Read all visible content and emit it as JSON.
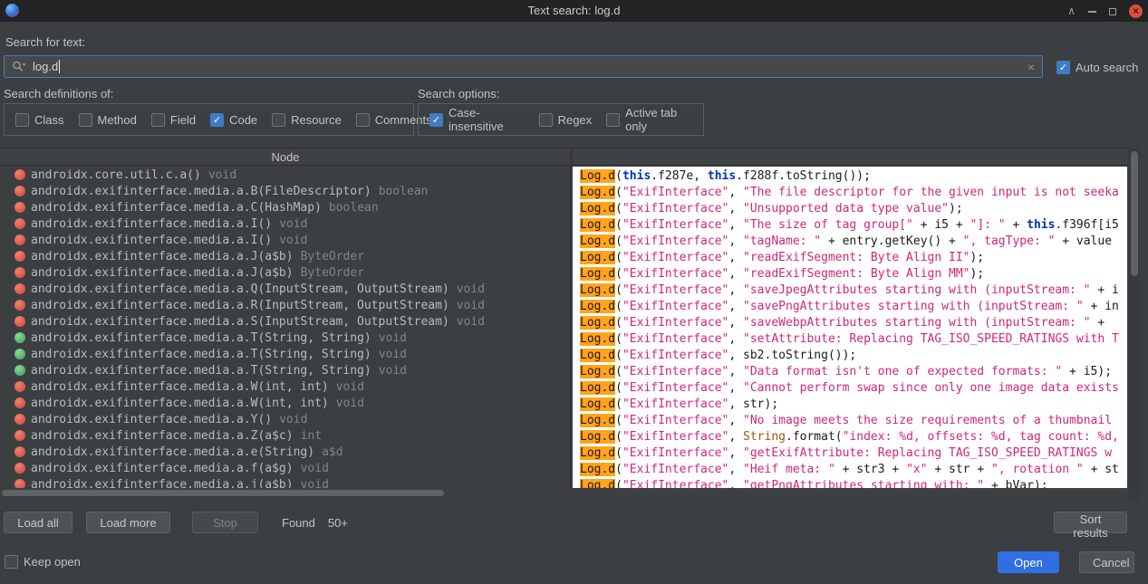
{
  "window": {
    "title": "Text search: log.d"
  },
  "search": {
    "label": "Search for text:",
    "value": "log.d",
    "clear_icon": "×",
    "auto_search": {
      "label": "Auto search",
      "checked": true
    }
  },
  "definitions": {
    "title": "Search definitions of:",
    "options": [
      {
        "label": "Class",
        "checked": false
      },
      {
        "label": "Method",
        "checked": false
      },
      {
        "label": "Field",
        "checked": false
      },
      {
        "label": "Code",
        "checked": true
      },
      {
        "label": "Resource",
        "checked": false
      },
      {
        "label": "Comments",
        "checked": false
      }
    ]
  },
  "options": {
    "title": "Search options:",
    "options": [
      {
        "label": "Case-insensitive",
        "checked": true
      },
      {
        "label": "Regex",
        "checked": false
      },
      {
        "label": "Active tab only",
        "checked": false
      }
    ]
  },
  "results": {
    "node_header": "Node",
    "rows": [
      {
        "icon": "method-red",
        "text": "androidx.core.util.c.a()",
        "type": "void"
      },
      {
        "icon": "method-red",
        "text": "androidx.exifinterface.media.a.B(FileDescriptor)",
        "type": "boolean"
      },
      {
        "icon": "method-red",
        "text": "androidx.exifinterface.media.a.C(HashMap)",
        "type": "boolean"
      },
      {
        "icon": "method-red",
        "text": "androidx.exifinterface.media.a.I()",
        "type": "void"
      },
      {
        "icon": "method-red",
        "text": "androidx.exifinterface.media.a.I()",
        "type": "void"
      },
      {
        "icon": "method-red",
        "text": "androidx.exifinterface.media.a.J(a$b)",
        "type": "ByteOrder"
      },
      {
        "icon": "method-red",
        "text": "androidx.exifinterface.media.a.J(a$b)",
        "type": "ByteOrder"
      },
      {
        "icon": "method-red",
        "text": "androidx.exifinterface.media.a.Q(InputStream, OutputStream)",
        "type": "void"
      },
      {
        "icon": "method-red",
        "text": "androidx.exifinterface.media.a.R(InputStream, OutputStream)",
        "type": "void"
      },
      {
        "icon": "method-red",
        "text": "androidx.exifinterface.media.a.S(InputStream, OutputStream)",
        "type": "void"
      },
      {
        "icon": "method-green",
        "text": "androidx.exifinterface.media.a.T(String, String)",
        "type": "void"
      },
      {
        "icon": "method-green",
        "text": "androidx.exifinterface.media.a.T(String, String)",
        "type": "void"
      },
      {
        "icon": "method-green",
        "text": "androidx.exifinterface.media.a.T(String, String)",
        "type": "void"
      },
      {
        "icon": "method-red",
        "text": "androidx.exifinterface.media.a.W(int, int)",
        "type": "void"
      },
      {
        "icon": "method-red",
        "text": "androidx.exifinterface.media.a.W(int, int)",
        "type": "void"
      },
      {
        "icon": "method-red",
        "text": "androidx.exifinterface.media.a.Y()",
        "type": "void"
      },
      {
        "icon": "method-red",
        "text": "androidx.exifinterface.media.a.Z(a$c)",
        "type": "int"
      },
      {
        "icon": "method-red",
        "text": "androidx.exifinterface.media.a.e(String)",
        "type": "a$d"
      },
      {
        "icon": "method-red",
        "text": "androidx.exifinterface.media.a.f(a$g)",
        "type": "void"
      },
      {
        "icon": "method-red",
        "text": "androidx.exifinterface.media.a.j(a$b)",
        "type": "void"
      }
    ],
    "code_lines": [
      "Log.d(this.f287e, this.f288f.toString());",
      "Log.d(\"ExifInterface\", \"The file descriptor for the given input is not seeka",
      "Log.d(\"ExifInterface\", \"Unsupported data type value\");",
      "Log.d(\"ExifInterface\", \"The size of tag group[\" + i5 + \"]: \" + this.f396f[i5",
      "Log.d(\"ExifInterface\", \"tagName: \" + entry.getKey() + \", tagType: \" + value",
      "Log.d(\"ExifInterface\", \"readExifSegment: Byte Align II\");",
      "Log.d(\"ExifInterface\", \"readExifSegment: Byte Align MM\");",
      "Log.d(\"ExifInterface\", \"saveJpegAttributes starting with (inputStream: \" + i",
      "Log.d(\"ExifInterface\", \"savePngAttributes starting with (inputStream: \" + in",
      "Log.d(\"ExifInterface\", \"saveWebpAttributes starting with (inputStream: \" + ",
      "Log.d(\"ExifInterface\", \"setAttribute: Replacing TAG_ISO_SPEED_RATINGS with T",
      "Log.d(\"ExifInterface\", sb2.toString());",
      "Log.d(\"ExifInterface\", \"Data format isn't one of expected formats: \" + i5);",
      "Log.d(\"ExifInterface\", \"Cannot perform swap since only one image data exists",
      "Log.d(\"ExifInterface\", str);",
      "Log.d(\"ExifInterface\", \"No image meets the size requirements of a thumbnail ",
      "Log.d(\"ExifInterface\", String.format(\"index: %d, offsets: %d, tag count: %d,",
      "Log.d(\"ExifInterface\", \"getExifAttribute: Replacing TAG_ISO_SPEED_RATINGS w",
      "Log.d(\"ExifInterface\", \"Heif meta: \" + str3 + \"x\" + str + \", rotation \" + st",
      "Log.d(\"ExifInterface\", \"getPngAttributes starting with: \" + bVar);"
    ]
  },
  "footer": {
    "load_all": "Load all",
    "load_more": "Load more",
    "stop": "Stop",
    "found_label": "Found",
    "found_count": "50+",
    "sort_results": "Sort results",
    "keep_open": {
      "label": "Keep open",
      "checked": false
    },
    "open": "Open",
    "cancel": "Cancel"
  },
  "icons": {
    "search_icon": "magnifier",
    "clear_icon": "×",
    "method_icon_colors": {
      "method-red": "#ce4335",
      "method-green": "#3f9d57"
    }
  },
  "colors": {
    "dialog_bg": "#3c3f41",
    "titlebar_bg": "#212325",
    "accent_blue": "#3f7cc4",
    "open_button_blue": "#2e6fe3",
    "close_button_red": "#e14b42",
    "match_highlight": "#ffa41c",
    "string_color": "#d02678",
    "keyword_color": "#0033b3",
    "code_bg": "#ffffff"
  }
}
